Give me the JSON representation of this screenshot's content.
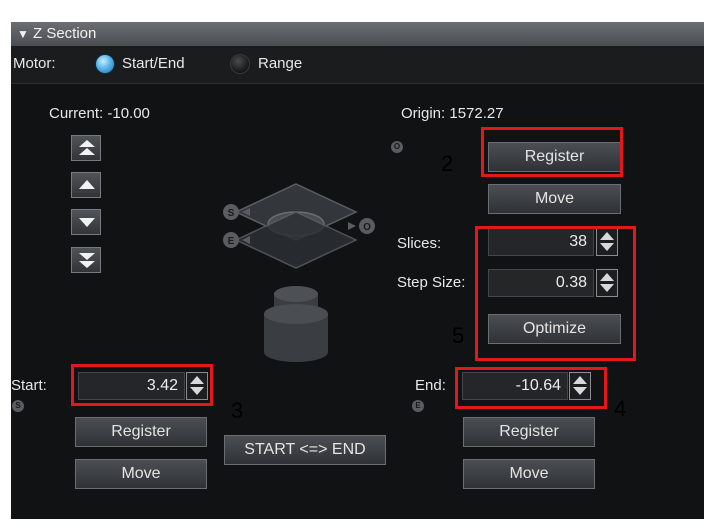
{
  "header": {
    "title": "Z Section"
  },
  "motor": {
    "label": "Motor:",
    "options": [
      {
        "label": "Start/End",
        "selected": true
      },
      {
        "label": "Range",
        "selected": false
      }
    ]
  },
  "current": {
    "label": "Current: -10.00"
  },
  "origin": {
    "label": "Origin: 1572.27",
    "register_label": "Register",
    "move_label": "Move",
    "marker": "O"
  },
  "slices": {
    "label": "Slices:",
    "value": "38"
  },
  "step_size": {
    "label": "Step Size:",
    "value": "0.38"
  },
  "optimize_label": "Optimize",
  "start": {
    "label": "Start:",
    "value": "3.42",
    "marker": "S",
    "register_label": "Register",
    "move_label": "Move"
  },
  "end": {
    "label": "End:",
    "value": "-10.64",
    "marker": "E",
    "register_label": "Register",
    "move_label": "Move"
  },
  "swap_label": "START <=> END",
  "diagram": {
    "start_marker": "S",
    "end_marker": "E",
    "origin_marker": "O"
  },
  "annotations": {
    "n2": "2",
    "n3": "3",
    "n4": "4",
    "n5": "5"
  },
  "colors": {
    "highlight": "#e01a1a",
    "radio_selected": "#3aa0df",
    "panel_bg": "#111213"
  }
}
